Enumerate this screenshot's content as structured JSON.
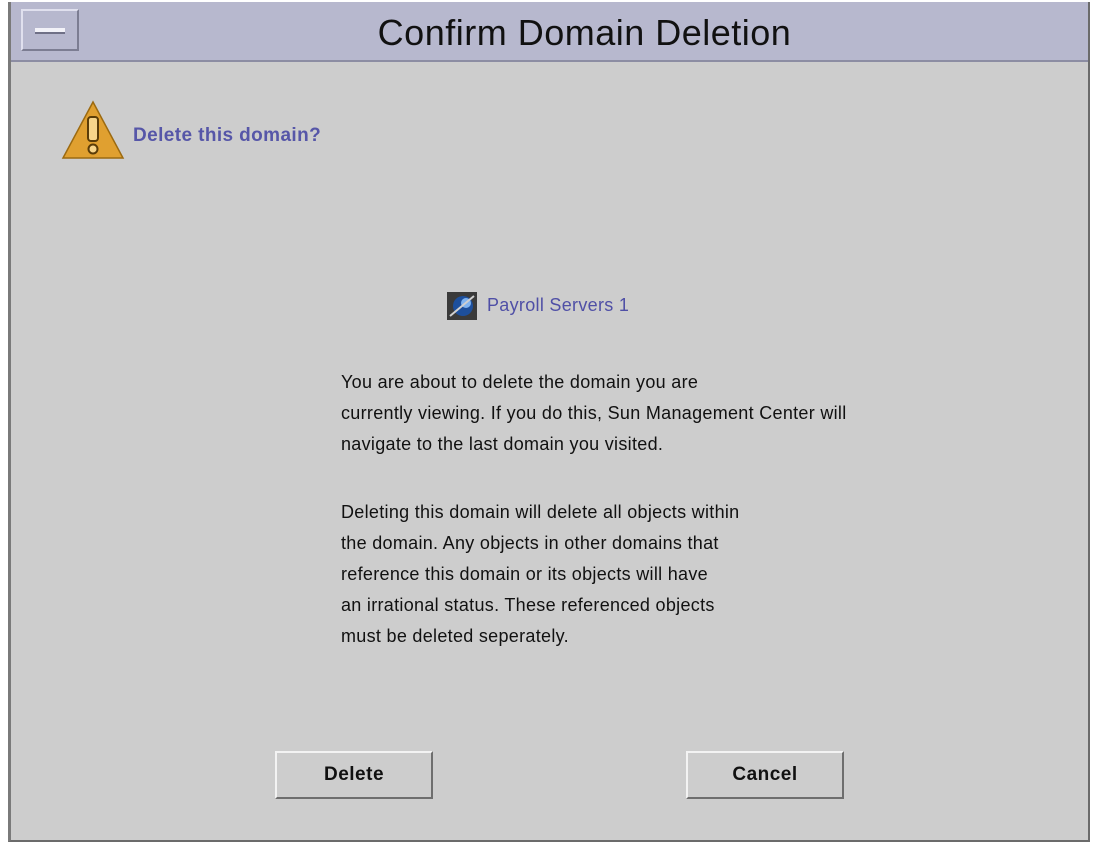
{
  "window": {
    "title": "Confirm Domain Deletion"
  },
  "dialog": {
    "icon": "warning-icon",
    "question": "Delete this domain?",
    "domain": {
      "icon": "domain-globe-icon",
      "name": "Payroll Servers 1"
    },
    "message_lines": [
      "You are about to delete the domain you are",
      "currently viewing.  If you do this, Sun Management Center will",
      "navigate to the last domain you visited."
    ],
    "detail_lines": [
      "Deleting this domain will delete all objects within",
      "the domain.  Any objects in other domains that",
      "reference this domain or its objects will have",
      "an irrational status.  These referenced objects",
      "must be deleted seperately."
    ]
  },
  "buttons": {
    "delete_label": "Delete",
    "cancel_label": "Cancel"
  },
  "colors": {
    "titlebar": "#b7b8ce",
    "background": "#cdcdcd",
    "accent_text": "#5656a8",
    "warning": "#e0a030"
  }
}
